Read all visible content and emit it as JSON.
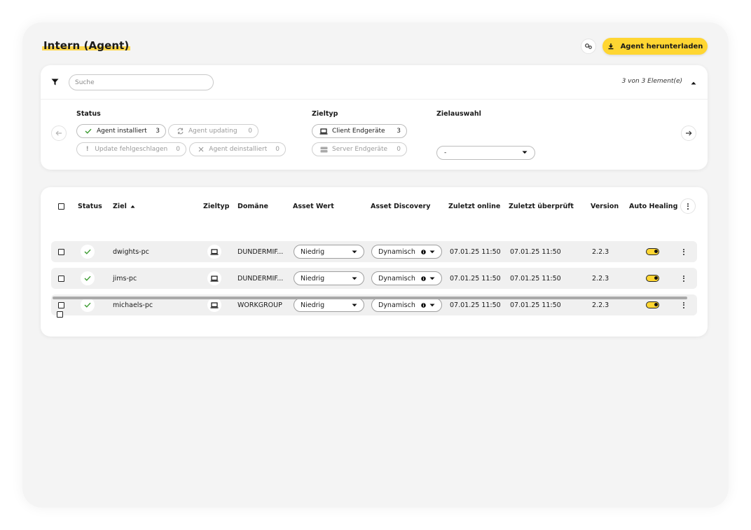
{
  "header": {
    "title": "Intern (Agent)",
    "download_label": "Agent herunterladen"
  },
  "filter": {
    "search_placeholder": "Suche",
    "count_text": "3 von 3 Element(e)",
    "status": {
      "label": "Status",
      "chips": [
        {
          "label": "Agent installiert",
          "count": "3",
          "icon": "check-icon",
          "disabled": false
        },
        {
          "label": "Agent updating",
          "count": "0",
          "icon": "sync-icon",
          "disabled": true
        },
        {
          "label": "Update fehlgeschlagen",
          "count": "0",
          "icon": "exclamation-icon",
          "disabled": true
        },
        {
          "label": "Agent deinstalliert",
          "count": "0",
          "icon": "x-icon",
          "disabled": true
        }
      ]
    },
    "zieltyp": {
      "label": "Zieltyp",
      "chips": [
        {
          "label": "Client Endgeräte",
          "count": "3",
          "icon": "laptop-icon",
          "disabled": false
        },
        {
          "label": "Server Endgeräte",
          "count": "0",
          "icon": "server-icon",
          "disabled": true
        }
      ]
    },
    "zielauswahl": {
      "label": "Zielauswahl",
      "value": "-"
    }
  },
  "table": {
    "columns": {
      "status": "Status",
      "ziel": "Ziel",
      "zieltyp": "Zieltyp",
      "domaene": "Domäne",
      "asset_wert": "Asset Wert",
      "asset_discovery": "Asset Discovery",
      "zuletzt_online": "Zuletzt online",
      "zuletzt_ueberprueft": "Zuletzt überprüft",
      "version": "Version",
      "auto_healing": "Auto Healing"
    },
    "rows": [
      {
        "ziel": "dwights-pc",
        "domaene": "DUNDERMIF...",
        "asset_wert": "Niedrig",
        "asset_discovery": "Dynamisch",
        "zuletzt_online": "07.01.25  11:50",
        "zuletzt_ueberprueft": "07.01.25  11:50",
        "version": "2.2.3",
        "auto_healing": true
      },
      {
        "ziel": "jims-pc",
        "domaene": "DUNDERMIF...",
        "asset_wert": "Niedrig",
        "asset_discovery": "Dynamisch",
        "zuletzt_online": "07.01.25  11:50",
        "zuletzt_ueberprueft": "07.01.25  11:50",
        "version": "2.2.3",
        "auto_healing": true
      },
      {
        "ziel": "michaels-pc",
        "domaene": "WORKGROUP",
        "asset_wert": "Niedrig",
        "asset_discovery": "Dynamisch",
        "zuletzt_online": "07.01.25  11:50",
        "zuletzt_ueberprueft": "07.01.25  11:50",
        "version": "2.2.3",
        "auto_healing": true
      }
    ]
  },
  "colors": {
    "accent": "#ffd632",
    "check": "#3a9b2f"
  }
}
